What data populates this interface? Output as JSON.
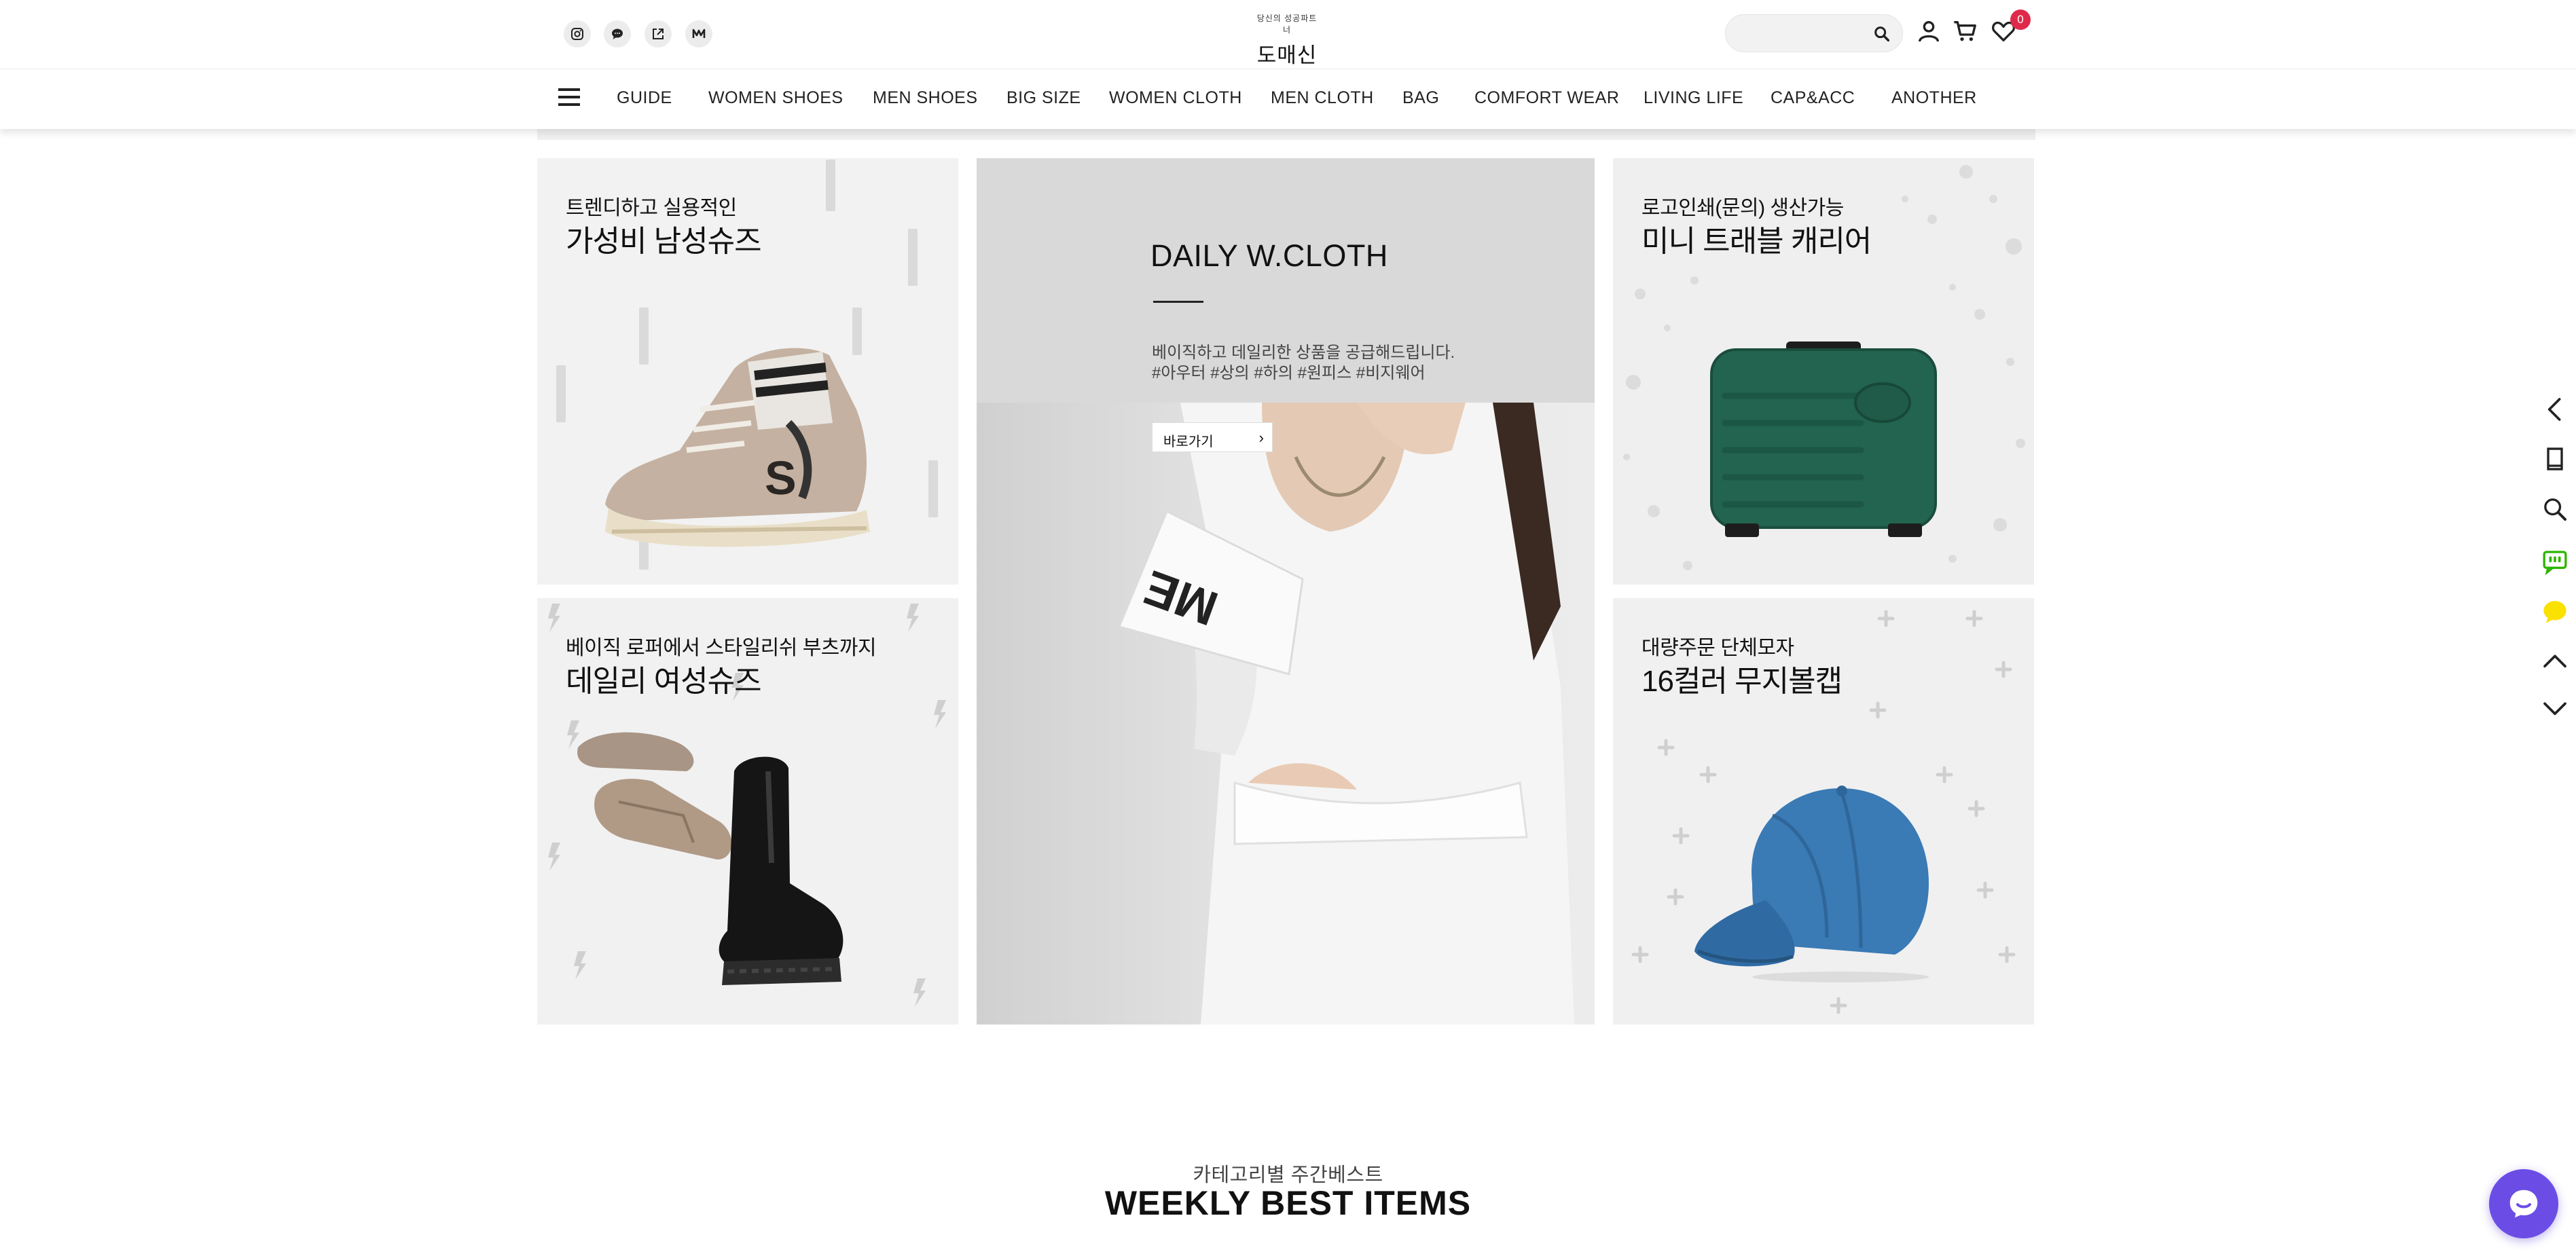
{
  "header": {
    "logo_tagline": "당신의 성공파트너",
    "logo_name": "도매신",
    "search_placeholder": "",
    "wishlist_count": "0",
    "sns_icons": [
      "instagram-icon",
      "chat-bubble-icon",
      "external-link-icon",
      "medium-icon"
    ],
    "user_icons": [
      "user-icon",
      "cart-icon",
      "heart-icon"
    ]
  },
  "nav": {
    "items": [
      "GUIDE",
      "WOMEN SHOES",
      "MEN SHOES",
      "BIG SIZE",
      "WOMEN CLOTH",
      "MEN CLOTH",
      "BAG",
      "COMFORT WEAR",
      "LIVING LIFE",
      "CAP&ACC",
      "ANOTHER"
    ]
  },
  "banners": {
    "men_shoes": {
      "sub": "트렌디하고 실용적인",
      "main": "가성비 남성슈즈"
    },
    "women_shoes": {
      "sub": "베이직 로퍼에서 스타일리쉬 부츠까지",
      "main": "데일리 여성슈즈"
    },
    "daily": {
      "title": "DAILY W.CLOTH",
      "desc1": "베이직하고 데일리한 상품을 공급해드립니다.",
      "desc2": "#아우터 #상의 #하의 #원피스 #비지웨어",
      "button": "바로가기",
      "button_arrow": "›"
    },
    "carrier": {
      "sub": "로고인쇄(문의) 생산가능",
      "main": "미니 트래블 캐리어"
    },
    "cap": {
      "sub": "대량주문 단체모자",
      "main": "16컬러 무지볼캡"
    }
  },
  "weekly": {
    "subtitle": "카테고리별 주간베스트",
    "title": "WEEKLY BEST ITEMS"
  },
  "quickbar": {
    "icons": [
      "back-icon",
      "recent-item-icon",
      "search-icon",
      "message-icon",
      "kakao-icon",
      "scroll-up-icon",
      "scroll-down-icon"
    ],
    "accent_green": "#2db400",
    "accent_yellow": "#fae100"
  },
  "chat_fab": {
    "color": "#6b4de6",
    "icon": "chat-icon"
  },
  "colors": {
    "badge": "#e0294a"
  }
}
